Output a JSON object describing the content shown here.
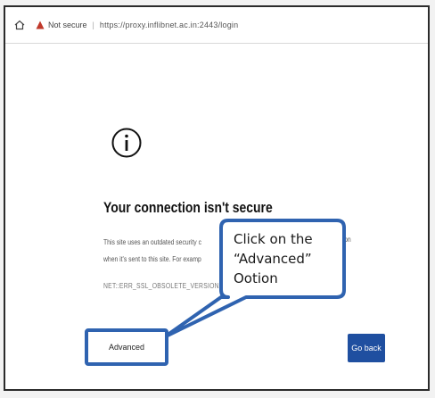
{
  "browser": {
    "security_label": "Not secure",
    "url": "https://proxy.inflibnet.ac.in:2443/login"
  },
  "page": {
    "heading": "Your connection isn't secure",
    "description_line1": "This site uses an outdated security c",
    "description_line2": "when it's sent to this site. For examp",
    "description_right": "information",
    "error_code": "NET::ERR_SSL_OBSOLETE_VERSION",
    "advanced_label": "Advanced",
    "go_back_label": "Go back"
  },
  "annotation": {
    "line1": "Click on the",
    "line2": "“Advanced”",
    "line3": "Ootion"
  },
  "colors": {
    "accent": "#2f63b0",
    "button": "#1f4fa0",
    "warning": "#c0392b"
  }
}
